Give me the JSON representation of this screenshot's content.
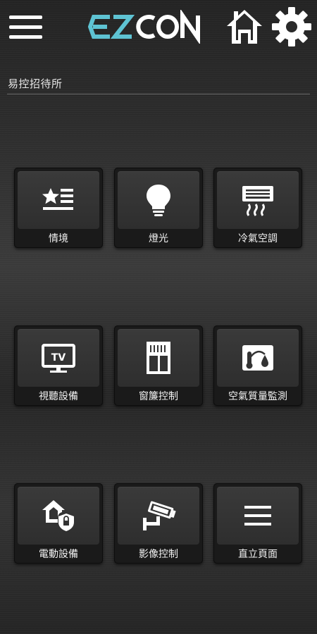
{
  "header": {
    "menu_icon": "hamburger-menu-icon",
    "logo_text": "EZCON",
    "home_icon": "home-icon",
    "settings_icon": "gear-icon"
  },
  "site": {
    "title": "易控招待所"
  },
  "tiles": [
    {
      "label": "情境",
      "icon": "scene-star-list-icon"
    },
    {
      "label": "燈光",
      "icon": "light-bulb-icon"
    },
    {
      "label": "冷氣空調",
      "icon": "air-conditioner-icon"
    },
    {
      "label": "視聽設備",
      "icon": "tv-icon"
    },
    {
      "label": "窗簾控制",
      "icon": "curtain-icon"
    },
    {
      "label": "空氣質量監測",
      "icon": "air-quality-icon"
    },
    {
      "label": "電動設備",
      "icon": "home-shield-icon"
    },
    {
      "label": "影像控制",
      "icon": "cctv-camera-icon"
    },
    {
      "label": "直立頁面",
      "icon": "list-lines-icon"
    }
  ],
  "colors": {
    "accent": "#5ec3d3",
    "text": "#ffffff",
    "background": "#2b2b2b"
  }
}
